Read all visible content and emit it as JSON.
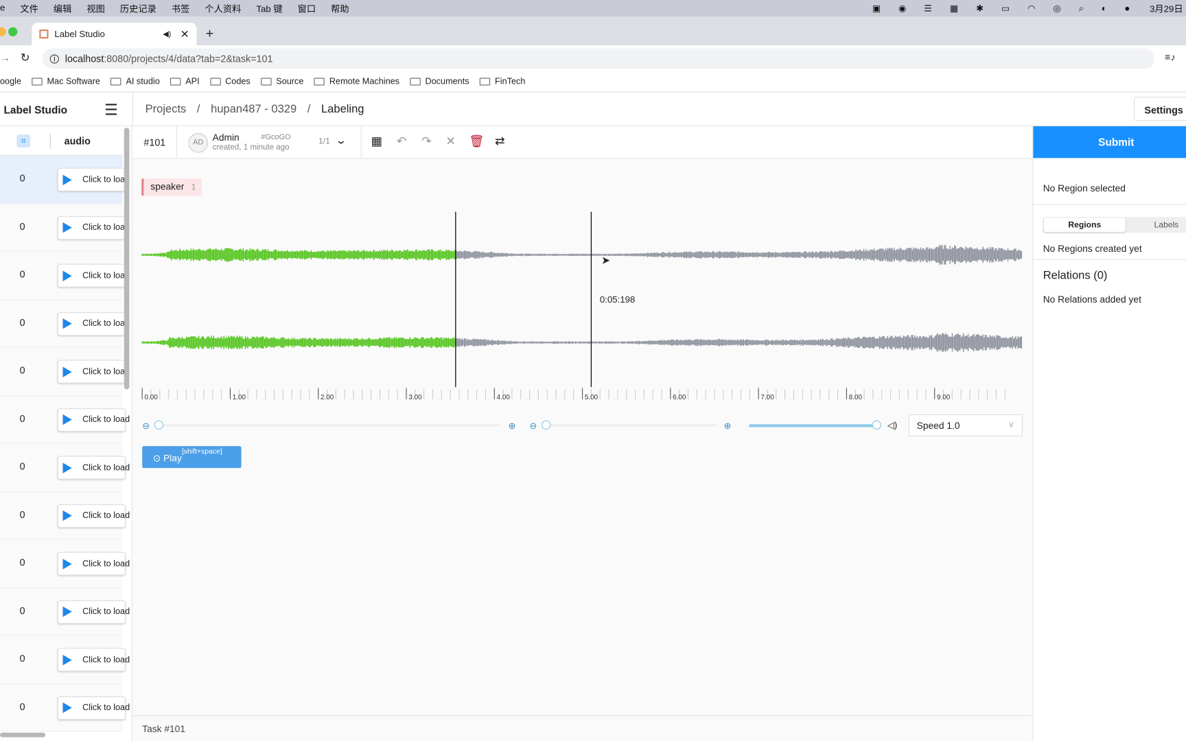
{
  "menubar": {
    "items": [
      "e",
      "文件",
      "编辑",
      "视图",
      "历史记录",
      "书签",
      "个人资料",
      "Tab 键",
      "窗口",
      "帮助"
    ],
    "clock": "3月29日"
  },
  "browser": {
    "tab_title": "Label Studio",
    "url_host": "localhost",
    "url_rest": ":8080/projects/4/data?tab=2&task=101",
    "bookmarks": [
      "oogle",
      "Mac Software",
      "AI studio",
      "API",
      "Codes",
      "Source",
      "Remote Machines",
      "Documents",
      "FinTech"
    ]
  },
  "app": {
    "name": "Label Studio",
    "breadcrumb": [
      "Projects",
      "hupan487 - 0329",
      "Labeling"
    ],
    "settings_label": "Settings"
  },
  "sidebar": {
    "column_header": "audio",
    "rows": [
      {
        "value": "0",
        "label": "Click to load"
      },
      {
        "value": "0",
        "label": "Click to load"
      },
      {
        "value": "0",
        "label": "Click to load"
      },
      {
        "value": "0",
        "label": "Click to load"
      },
      {
        "value": "0",
        "label": "Click to load"
      },
      {
        "value": "0",
        "label": "Click to load"
      },
      {
        "value": "0",
        "label": "Click to load"
      },
      {
        "value": "0",
        "label": "Click to load"
      },
      {
        "value": "0",
        "label": "Click to load"
      },
      {
        "value": "0",
        "label": "Click to load"
      },
      {
        "value": "0",
        "label": "Click to load"
      },
      {
        "value": "0",
        "label": "Click to load"
      }
    ]
  },
  "task": {
    "id": "#101",
    "avatar": "AD",
    "user": "Admin",
    "annotation_id": "#GcoGO",
    "created": "created, 1 minute ago",
    "pager": "1/1",
    "footer": "Task #101"
  },
  "labels": [
    {
      "name": "speaker",
      "hotkey": "1",
      "color": "#e57f87"
    }
  ],
  "audio": {
    "cursor_time": "0:05:198",
    "progress_seconds": 3.56,
    "cursor_seconds": 5.2,
    "duration_seconds": 10,
    "ruler": [
      "0.00",
      "1.00",
      "2.00",
      "3.00",
      "4.00",
      "5.00",
      "6.00",
      "7.00",
      "8.00",
      "9.00"
    ],
    "played_color": "#52c41a",
    "unplayed_color": "#8c909c",
    "volume": 1.0,
    "zoom": 0,
    "speed_label": "Speed 1.0",
    "play_label": "Play",
    "play_hotkey": "[shift+space]"
  },
  "right": {
    "submit_label": "Submit",
    "no_region": "No Region selected",
    "tabs": [
      "Regions",
      "Labels"
    ],
    "active_tab": "Regions",
    "no_regions": "No Regions created yet",
    "relations_title": "Relations (0)",
    "no_relations": "No Relations added yet"
  },
  "colors": {
    "accent": "#1890ff",
    "delete": "#c0152f"
  }
}
